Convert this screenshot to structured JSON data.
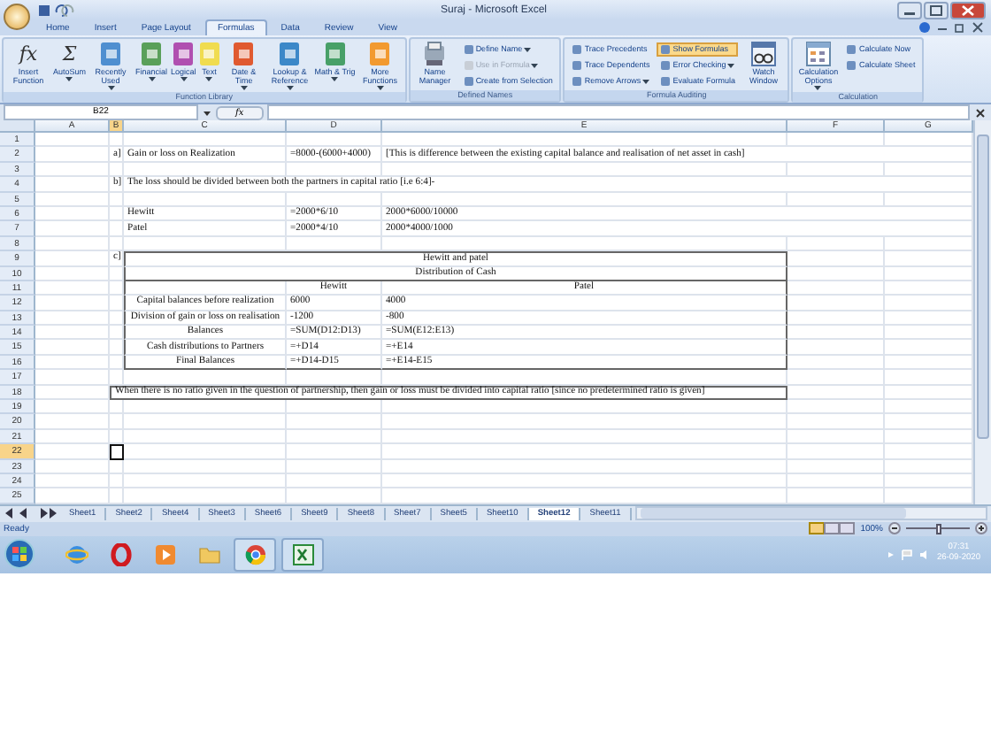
{
  "window": {
    "title": "Suraj - Microsoft Excel"
  },
  "ribbon_tabs": [
    {
      "label": "Home",
      "selected": false
    },
    {
      "label": "Insert",
      "selected": false
    },
    {
      "label": "Page Layout",
      "selected": false
    },
    {
      "label": "Formulas",
      "selected": true
    },
    {
      "label": "Data",
      "selected": false
    },
    {
      "label": "Review",
      "selected": false
    },
    {
      "label": "View",
      "selected": false
    }
  ],
  "ribbon_groups": [
    {
      "label": "Function Library",
      "items": [
        {
          "kind": "glyph",
          "glyph": "fx",
          "label": "Insert Function",
          "dropdown": false
        },
        {
          "kind": "glyph",
          "glyph": "Σ",
          "label": "AutoSum",
          "dropdown": true
        },
        {
          "kind": "book",
          "color": "#4f8fd0",
          "label": "Recently Used",
          "dropdown": true
        },
        {
          "kind": "book",
          "color": "#5aa05a",
          "label": "Financial",
          "dropdown": true
        },
        {
          "kind": "book",
          "color": "#b050b0",
          "label": "Logical",
          "dropdown": true
        },
        {
          "kind": "book",
          "color": "#f0dc50",
          "label": "Text",
          "dropdown": true
        },
        {
          "kind": "book",
          "color": "#e05a30",
          "label": "Date & Time",
          "dropdown": true
        },
        {
          "kind": "book",
          "color": "#3c88c8",
          "label": "Lookup & Reference",
          "dropdown": true
        },
        {
          "kind": "book",
          "color": "#48a068",
          "label": "Math & Trig",
          "dropdown": true
        },
        {
          "kind": "book",
          "color": "#f29a30",
          "label": "More Functions",
          "dropdown": true
        }
      ]
    },
    {
      "label": "Defined Names",
      "items": [
        {
          "kind": "manager",
          "label": "Name Manager",
          "dropdown": false
        },
        {
          "kind": "stack",
          "items": [
            {
              "label": "Define Name",
              "dropdown": true,
              "disabled": false,
              "on": false
            },
            {
              "label": "Use in Formula",
              "dropdown": true,
              "disabled": true,
              "on": false
            },
            {
              "label": "Create from Selection",
              "dropdown": false,
              "disabled": false,
              "on": false
            }
          ]
        }
      ]
    },
    {
      "label": "Formula Auditing",
      "items": [
        {
          "kind": "stack",
          "items": [
            {
              "label": "Trace Precedents",
              "dropdown": false,
              "disabled": false,
              "on": false
            },
            {
              "label": "Trace Dependents",
              "dropdown": false,
              "disabled": false,
              "on": false
            },
            {
              "label": "Remove Arrows",
              "dropdown": true,
              "disabled": false,
              "on": false
            }
          ]
        },
        {
          "kind": "stack",
          "items": [
            {
              "label": "Show Formulas",
              "dropdown": false,
              "disabled": false,
              "on": true
            },
            {
              "label": "Error Checking",
              "dropdown": true,
              "disabled": false,
              "on": false
            },
            {
              "label": "Evaluate Formula",
              "dropdown": false,
              "disabled": false,
              "on": false
            }
          ]
        },
        {
          "kind": "watch",
          "label": "Watch Window",
          "dropdown": false
        }
      ]
    },
    {
      "label": "Calculation",
      "items": [
        {
          "kind": "calc",
          "label": "Calculation Options",
          "dropdown": true
        },
        {
          "kind": "stack",
          "items": [
            {
              "label": "Calculate Now",
              "dropdown": false,
              "disabled": false,
              "on": false
            },
            {
              "label": "Calculate Sheet",
              "dropdown": false,
              "disabled": false,
              "on": false
            }
          ]
        }
      ]
    }
  ],
  "formula_bar": {
    "name_box": "B22",
    "fx": "fx"
  },
  "columns": [
    {
      "label": "A",
      "selected": false
    },
    {
      "label": "B",
      "selected": true
    },
    {
      "label": "C",
      "selected": false
    },
    {
      "label": "D",
      "selected": false
    },
    {
      "label": "E",
      "selected": false
    },
    {
      "label": "F",
      "selected": false
    },
    {
      "label": "G",
      "selected": false
    }
  ],
  "rows": [
    {
      "num": "1",
      "selected": false,
      "kind": "plain"
    },
    {
      "num": "2",
      "selected": false,
      "kind": "plain",
      "B": "a]",
      "C": "Gain or loss on Realization",
      "D": "=8000-(6000+4000)",
      "E": "[This is difference between the existing capital balance and realisation of net asset in cash]"
    },
    {
      "num": "3",
      "selected": false,
      "kind": "plain"
    },
    {
      "num": "4",
      "selected": false,
      "kind": "plain",
      "B": "b]",
      "C": "The loss should be divided between both the partners in capital ratio [i.e 6:4]-"
    },
    {
      "num": "5",
      "selected": false,
      "kind": "plain"
    },
    {
      "num": "6",
      "selected": false,
      "kind": "plain",
      "C": "Hewitt",
      "D": "=2000*6/10",
      "E": "2000*6000/10000"
    },
    {
      "num": "7",
      "selected": false,
      "kind": "plain",
      "C": "Patel",
      "D": "=2000*4/10",
      "E": "2000*4000/1000"
    },
    {
      "num": "8",
      "selected": false,
      "kind": "plain"
    },
    {
      "num": "9",
      "selected": false,
      "kind": "table-title",
      "B": "c]",
      "C": "Hewitt and patel"
    },
    {
      "num": "10",
      "selected": false,
      "kind": "table-subtitle",
      "C": "Distribution of Cash"
    },
    {
      "num": "11",
      "selected": false,
      "kind": "table-header",
      "D": "Hewitt",
      "E": "Patel"
    },
    {
      "num": "12",
      "selected": false,
      "kind": "table-row",
      "C": "Capital balances before realization",
      "D": "6000",
      "E": "4000"
    },
    {
      "num": "13",
      "selected": false,
      "kind": "table-row",
      "C": "Division of gain or loss on realisation",
      "D": "-1200",
      "E": "-800"
    },
    {
      "num": "14",
      "selected": false,
      "kind": "table-row",
      "C": "Balances",
      "D": "=SUM(D12:D13)",
      "E": "=SUM(E12:E13)"
    },
    {
      "num": "15",
      "selected": false,
      "kind": "table-row",
      "C": "Cash distributions to Partners",
      "D": "=+D14",
      "E": "=+E14"
    },
    {
      "num": "16",
      "selected": false,
      "kind": "table-last",
      "C": "Final Balances",
      "D": "=+D14-D15",
      "E": "=+E14-E15"
    },
    {
      "num": "17",
      "selected": false,
      "kind": "plain"
    },
    {
      "num": "18",
      "selected": false,
      "kind": "note",
      "B": "When there is no ratio given in the question of partnership, then gain or loss must be divided into capital ratio [since no predetermined ratio is given]"
    },
    {
      "num": "19",
      "selected": false,
      "kind": "plain"
    },
    {
      "num": "20",
      "selected": false,
      "kind": "plain"
    },
    {
      "num": "21",
      "selected": false,
      "kind": "plain"
    },
    {
      "num": "22",
      "selected": true,
      "kind": "plain"
    },
    {
      "num": "23",
      "selected": false,
      "kind": "plain"
    },
    {
      "num": "24",
      "selected": false,
      "kind": "plain"
    },
    {
      "num": "25",
      "selected": false,
      "kind": "plain"
    }
  ],
  "sheet_tabs": [
    {
      "label": "Sheet1",
      "selected": false
    },
    {
      "label": "Sheet2",
      "selected": false
    },
    {
      "label": "Sheet4",
      "selected": false
    },
    {
      "label": "Sheet3",
      "selected": false
    },
    {
      "label": "Sheet6",
      "selected": false
    },
    {
      "label": "Sheet9",
      "selected": false
    },
    {
      "label": "Sheet8",
      "selected": false
    },
    {
      "label": "Sheet7",
      "selected": false
    },
    {
      "label": "Sheet5",
      "selected": false
    },
    {
      "label": "Sheet10",
      "selected": false
    },
    {
      "label": "Sheet12",
      "selected": true
    },
    {
      "label": "Sheet11",
      "selected": false
    }
  ],
  "status_bar": {
    "status": "Ready",
    "zoom": "100%",
    "zoom_slider": {
      "level": 0.5
    }
  },
  "taskbar": {
    "apps": [
      {
        "kind": "ie",
        "open": false
      },
      {
        "kind": "opera",
        "open": false
      },
      {
        "kind": "media",
        "open": false
      },
      {
        "kind": "folder",
        "open": false
      },
      {
        "kind": "chrome",
        "open": true
      },
      {
        "kind": "excel",
        "open": true
      }
    ],
    "time": "07:31",
    "date": "26-09-2020"
  }
}
